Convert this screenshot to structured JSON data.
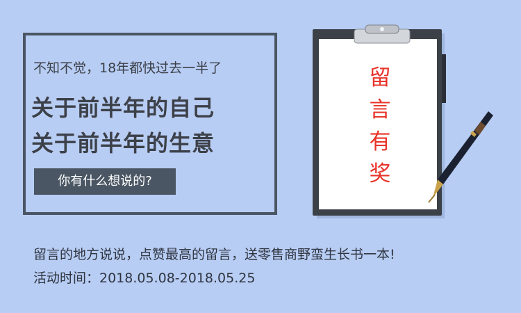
{
  "banner": {
    "subtitle": "不知不觉，18年都快过去一半了",
    "headline_1": "关于前半年的自己",
    "headline_2": "关于前半年的生意",
    "question": "你有什么想说的?"
  },
  "clipboard": {
    "chars": [
      "留",
      "言",
      "有",
      "奖"
    ]
  },
  "footer": {
    "line_1": "留言的地方说说，点赞最高的留言，送零售商野蛮生长书一本!",
    "line_2": "活动时间：2018.05.08-2018.05.25"
  },
  "colors": {
    "background": "#b8cdf4",
    "frame": "#4a5663",
    "accent_red": "#e8342a"
  },
  "icons": [
    "clipboard-icon",
    "fountain-pen-icon"
  ]
}
